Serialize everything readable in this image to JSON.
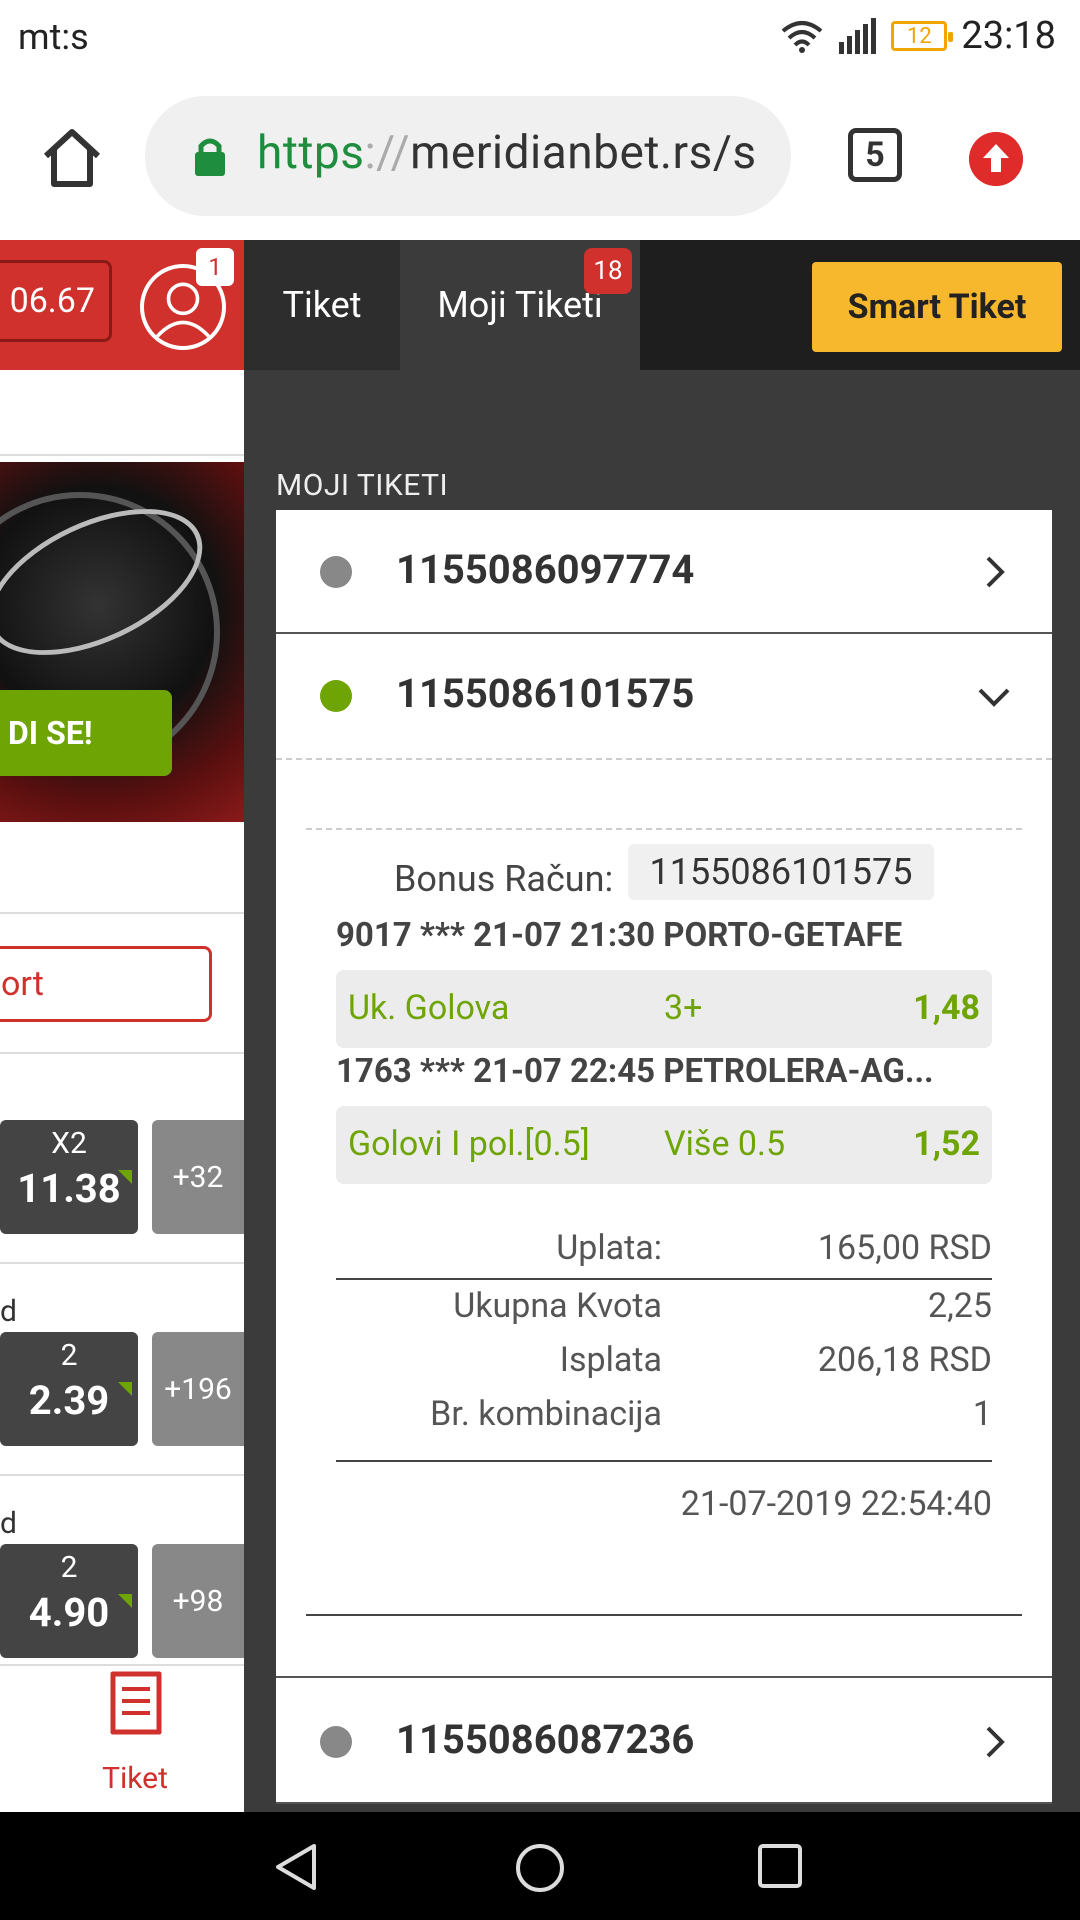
{
  "status": {
    "carrier": "mt:s",
    "battery": "12",
    "time": "23:18"
  },
  "browser": {
    "url_scheme": "https",
    "url_sep": "://",
    "url_host": "meridianbet.rs/s",
    "tabs_count": "5"
  },
  "left": {
    "balance": "06.67",
    "avatar_badge": "1",
    "banner_button": "DI SE!",
    "sport_button": "ort",
    "rows": [
      {
        "label": "",
        "odd_label": "X2",
        "odd_value": "11.38",
        "more": "+32"
      },
      {
        "label": "d",
        "odd_label": "2",
        "odd_value": "2.39",
        "more": "+196"
      },
      {
        "label": "d",
        "odd_label": "2",
        "odd_value": "4.90",
        "more": "+98"
      }
    ],
    "tiket_label": "Tiket"
  },
  "right": {
    "tabs": {
      "tiket": "Tiket",
      "moji_tiketi": "Moji Tiketi",
      "badge": "18",
      "smart": "Smart Tiket"
    },
    "section_title": "MOJI TIKETI",
    "tickets": [
      "1155086097774",
      "1155086101575",
      "1155086087236"
    ],
    "detail": {
      "bonus_label": "Bonus Račun:",
      "bonus_value": "1155086101575",
      "matches": [
        {
          "title": "9017 *** 21-07 21:30 PORTO-GETAFE",
          "market": "Uk. Golova",
          "selection": "3+",
          "odd": "1,48"
        },
        {
          "title": "1763 *** 21-07 22:45 PETROLERA-AG...",
          "market": "Golovi I pol.[0.5]",
          "selection": "Više 0.5",
          "odd": "1,52"
        }
      ],
      "uplata_k": "Uplata:",
      "uplata_v": "165,00 RSD",
      "kvota_k": "Ukupna Kvota",
      "kvota_v": "2,25",
      "isplata_k": "Isplata",
      "isplata_v": "206,18 RSD",
      "komb_k": "Br. kombinacija",
      "komb_v": "1",
      "timestamp": "21-07-2019 22:54:40"
    }
  },
  "colors": {
    "accent_red": "#d0312d",
    "accent_green": "#6ea504",
    "smart_yellow": "#f8b82e"
  }
}
